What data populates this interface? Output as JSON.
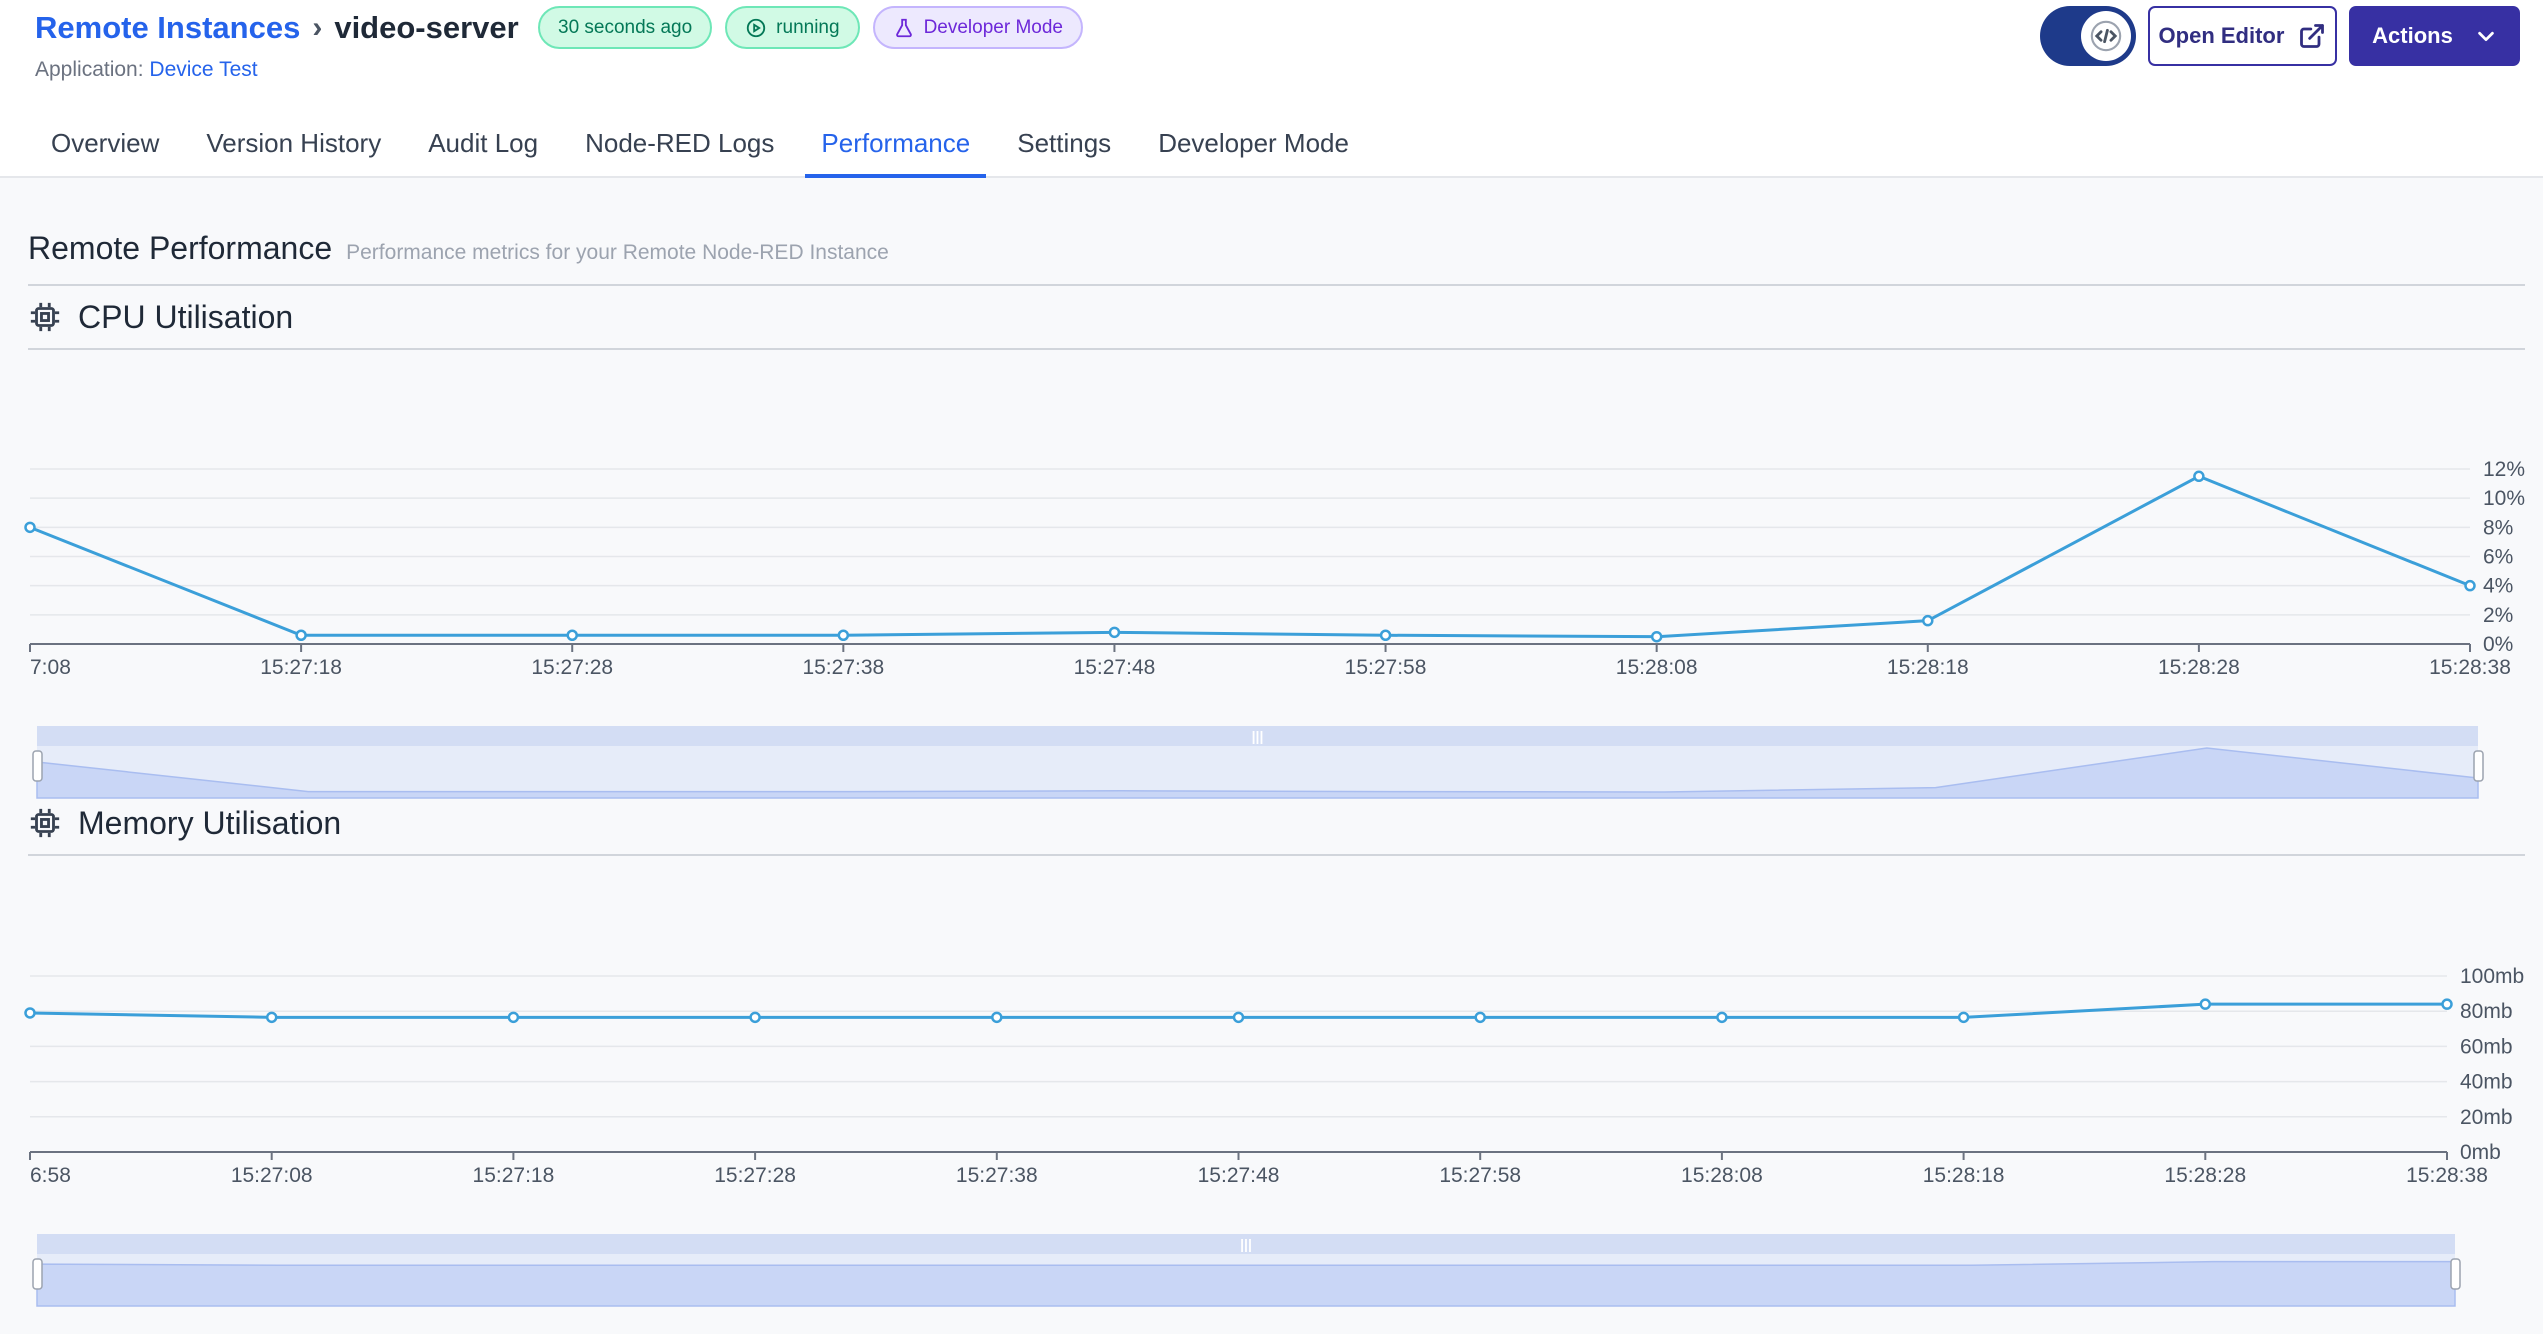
{
  "header": {
    "breadcrumb_root": "Remote Instances",
    "breadcrumb_current": "video-server",
    "badges": {
      "updated": "30 seconds ago",
      "status": "running",
      "mode": "Developer Mode"
    },
    "application_label": "Application:",
    "application_name": "Device Test",
    "open_editor_label": "Open Editor",
    "actions_label": "Actions"
  },
  "tabs": [
    {
      "label": "Overview",
      "active": false
    },
    {
      "label": "Version History",
      "active": false
    },
    {
      "label": "Audit Log",
      "active": false
    },
    {
      "label": "Node-RED Logs",
      "active": false
    },
    {
      "label": "Performance",
      "active": true
    },
    {
      "label": "Settings",
      "active": false
    },
    {
      "label": "Developer Mode",
      "active": false
    }
  ],
  "page": {
    "title": "Remote Performance",
    "subtitle": "Performance metrics for your Remote Node-RED Instance"
  },
  "colors": {
    "accent": "#2563eb",
    "line": "#3b9fd9",
    "primary_button": "#3730a3",
    "running_badge": "#d1fae5",
    "developer_badge": "#ede9fe"
  },
  "chart_data": [
    {
      "type": "line",
      "title": "CPU Utilisation",
      "x": [
        "7:08",
        "15:27:18",
        "15:27:28",
        "15:27:38",
        "15:27:48",
        "15:27:58",
        "15:28:08",
        "15:28:18",
        "15:28:28",
        "15:28:38"
      ],
      "series": [
        {
          "values": [
            8.0,
            0.6,
            0.6,
            0.6,
            0.8,
            0.6,
            0.5,
            1.6,
            11.5,
            4.0
          ]
        }
      ],
      "y_ticks": [
        "0%",
        "2%",
        "4%",
        "6%",
        "8%",
        "10%",
        "12%"
      ],
      "ylim": [
        0,
        12
      ],
      "y_axis_position": "right",
      "grid": true,
      "zoom_slider": true
    },
    {
      "type": "line",
      "title": "Memory Utilisation",
      "x": [
        "6:58",
        "15:27:08",
        "15:27:18",
        "15:27:28",
        "15:27:38",
        "15:27:48",
        "15:27:58",
        "15:28:08",
        "15:28:18",
        "15:28:28",
        "15:28:38"
      ],
      "series": [
        {
          "values": [
            79,
            76.5,
            76.5,
            76.5,
            76.5,
            76.5,
            76.5,
            76.5,
            76.5,
            84,
            84
          ]
        }
      ],
      "y_ticks": [
        "0mb",
        "20mb",
        "40mb",
        "60mb",
        "80mb",
        "100mb"
      ],
      "ylim": [
        0,
        100
      ],
      "y_axis_position": "right",
      "grid": true,
      "zoom_slider": true
    }
  ]
}
